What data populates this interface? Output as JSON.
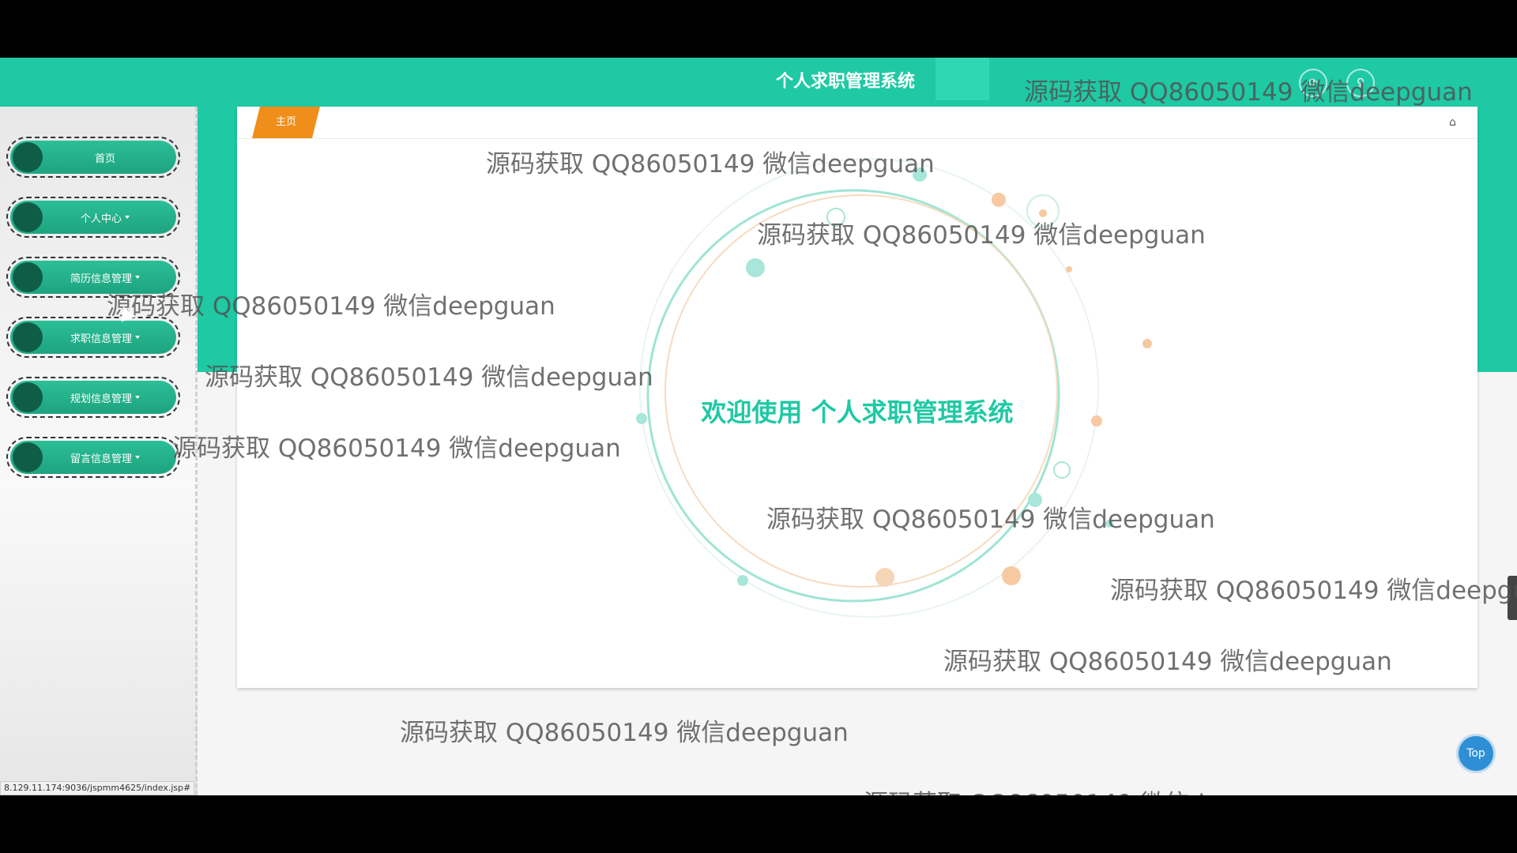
{
  "app": {
    "title": "个人求职管理系统",
    "accent_color": "#1fc9a4",
    "tab_color": "#f08e1b"
  },
  "header": {
    "title": "个人求职管理系统",
    "icons": [
      "refresh-icon",
      "user-icon"
    ]
  },
  "sidebar": {
    "items": [
      {
        "label": "首页",
        "has_caret": false
      },
      {
        "label": "个人中心",
        "has_caret": true
      },
      {
        "label": "简历信息管理",
        "has_caret": true
      },
      {
        "label": "求职信息管理",
        "has_caret": true
      },
      {
        "label": "规划信息管理",
        "has_caret": true
      },
      {
        "label": "留言信息管理",
        "has_caret": true
      }
    ]
  },
  "tabs": {
    "home_label": "主页",
    "home_icon": "home-icon"
  },
  "welcome": {
    "text": "欢迎使用 个人求职管理系统"
  },
  "status_bar": {
    "url": "8.129.11.174:9036/jspmm4625/index.jsp#"
  },
  "top_button": {
    "label": "Top"
  },
  "watermark": {
    "text": "源码获取 QQ86050149 微信deepguan"
  }
}
